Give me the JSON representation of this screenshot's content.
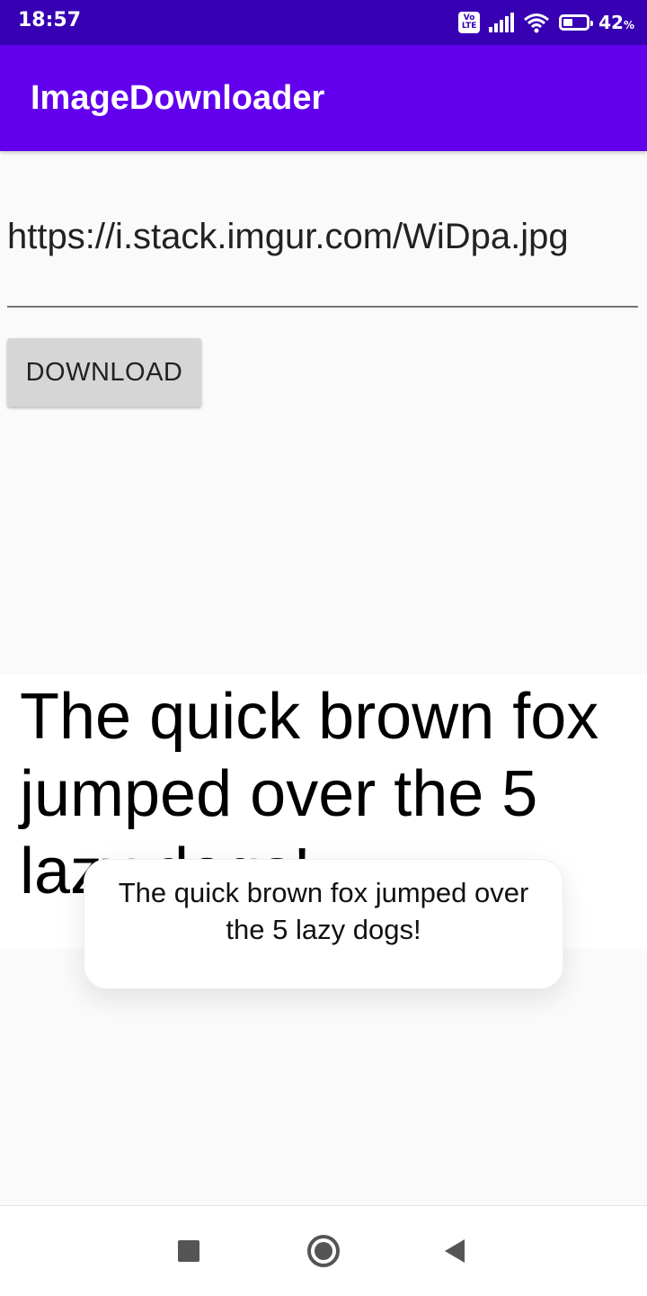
{
  "status_bar": {
    "time": "18:57",
    "volte_top": "Vo",
    "volte_bottom": "LTE",
    "battery_percent": "42",
    "battery_unit": "%",
    "battery_level": 0.42
  },
  "app_bar": {
    "title": "ImageDownloader"
  },
  "url_field": {
    "value": "https://i.stack.imgur.com/WiDpa.jpg"
  },
  "download_button": {
    "label": "DOWNLOAD"
  },
  "image_view": {
    "text": "The quick brown fox jumped over the 5 lazy dogs!"
  },
  "toast": {
    "message": "The quick brown fox jumped over the 5 lazy dogs!"
  },
  "nav_bar": {
    "recents_icon": "square-icon",
    "home_icon": "circle-icon",
    "back_icon": "triangle-back-icon"
  }
}
